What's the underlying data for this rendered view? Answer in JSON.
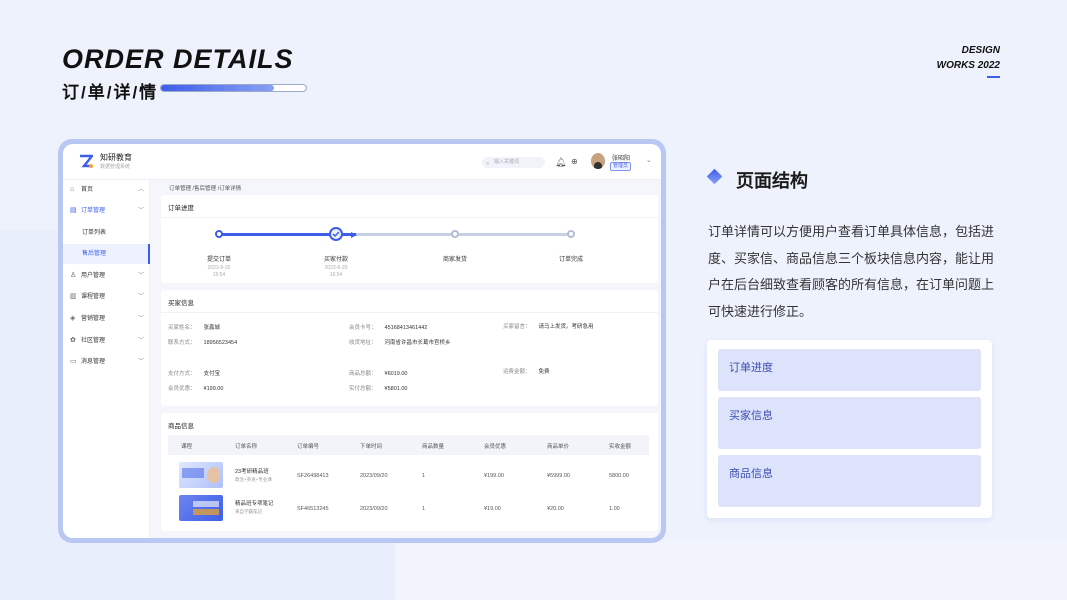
{
  "header": {
    "title_en": "ORDER DETAILS",
    "title_cn": "订/单/详/情",
    "progress": 0.78,
    "design_line1": "DESIGN",
    "design_line2": "WORKS 2022"
  },
  "app": {
    "brand": "知研教育",
    "brand_sub": "数据管理系统",
    "search_placeholder": "输入关键词",
    "user_name": "张昭阳",
    "user_role": "管理员",
    "breadcrumb": "订单管理  /售后管理  /订单详情"
  },
  "sidebar": {
    "items": [
      {
        "label": "首页",
        "icon": "home-icon"
      },
      {
        "label": "订单管理",
        "icon": "order-icon"
      },
      {
        "label": "订单列表"
      },
      {
        "label": "售后管理"
      },
      {
        "label": "用户管理",
        "icon": "user-icon"
      },
      {
        "label": "课程管理",
        "icon": "course-icon"
      },
      {
        "label": "营销管理",
        "icon": "tag-icon"
      },
      {
        "label": "社区管理",
        "icon": "community-icon"
      },
      {
        "label": "消息管理",
        "icon": "message-icon"
      }
    ]
  },
  "progress_card": {
    "title": "订单进度",
    "steps": [
      {
        "label": "提交订单",
        "date": "2023-9-20",
        "time": "15:54",
        "done": true
      },
      {
        "label": "买家付款",
        "date": "2023-9-20",
        "time": "16:54",
        "done": true
      },
      {
        "label": "商家发货",
        "done": false
      },
      {
        "label": "订单完成",
        "done": false
      }
    ]
  },
  "buyer_card": {
    "title": "买家信息",
    "fields": {
      "name_k": "买家姓名：",
      "name_v": "张鑫城",
      "member_k": "会员卡号：",
      "member_v": "45168413461442",
      "message_k": "买家留言：",
      "message_v": "请马上发货。考研急用",
      "phone_k": "联系方式：",
      "phone_v": "18956523454",
      "address_k": "收货地址：",
      "address_v": "河南省许昌市长葛市官桥乡",
      "pay_k": "支付方式：",
      "pay_v": "支付宝",
      "total_k": "商品总额：",
      "total_v": "¥6019.00",
      "ship_k": "运费金额：",
      "ship_v": "免费",
      "discount_k": "会员优惠：",
      "discount_v": "¥199.00",
      "paid_k": "实付总额：",
      "paid_v": "¥5801.00"
    }
  },
  "goods_card": {
    "title": "商品信息",
    "columns": [
      "课程",
      "订单名称",
      "订单编号",
      "下单时间",
      "商品数量",
      "会员优惠",
      "商品单价",
      "实收金额"
    ],
    "rows": [
      {
        "name": "23考研精品班",
        "sub": "政治+英语+专业课",
        "no": "SF26498413",
        "date": "2023/09/20",
        "qty": "1",
        "discount": "¥199.00",
        "price": "¥5999.00",
        "received": "5800.00"
      },
      {
        "name": "精品班专项笔记",
        "sub": "来自学霸笔记",
        "no": "SF46513245",
        "date": "2023/09/20",
        "qty": "1",
        "discount": "¥19.00",
        "price": "¥20.00",
        "received": "1.00"
      }
    ]
  },
  "right": {
    "title": "页面结构",
    "desc": "订单详情可以方便用户查看订单具体信息，包括进度、买家信、商品信息三个板块信息内容，能让用户在后台细致查看顾客的所有信息，在订单问题上可快速进行修正。",
    "boxes": [
      "订单进度",
      "买家信息",
      "商品信息"
    ]
  }
}
